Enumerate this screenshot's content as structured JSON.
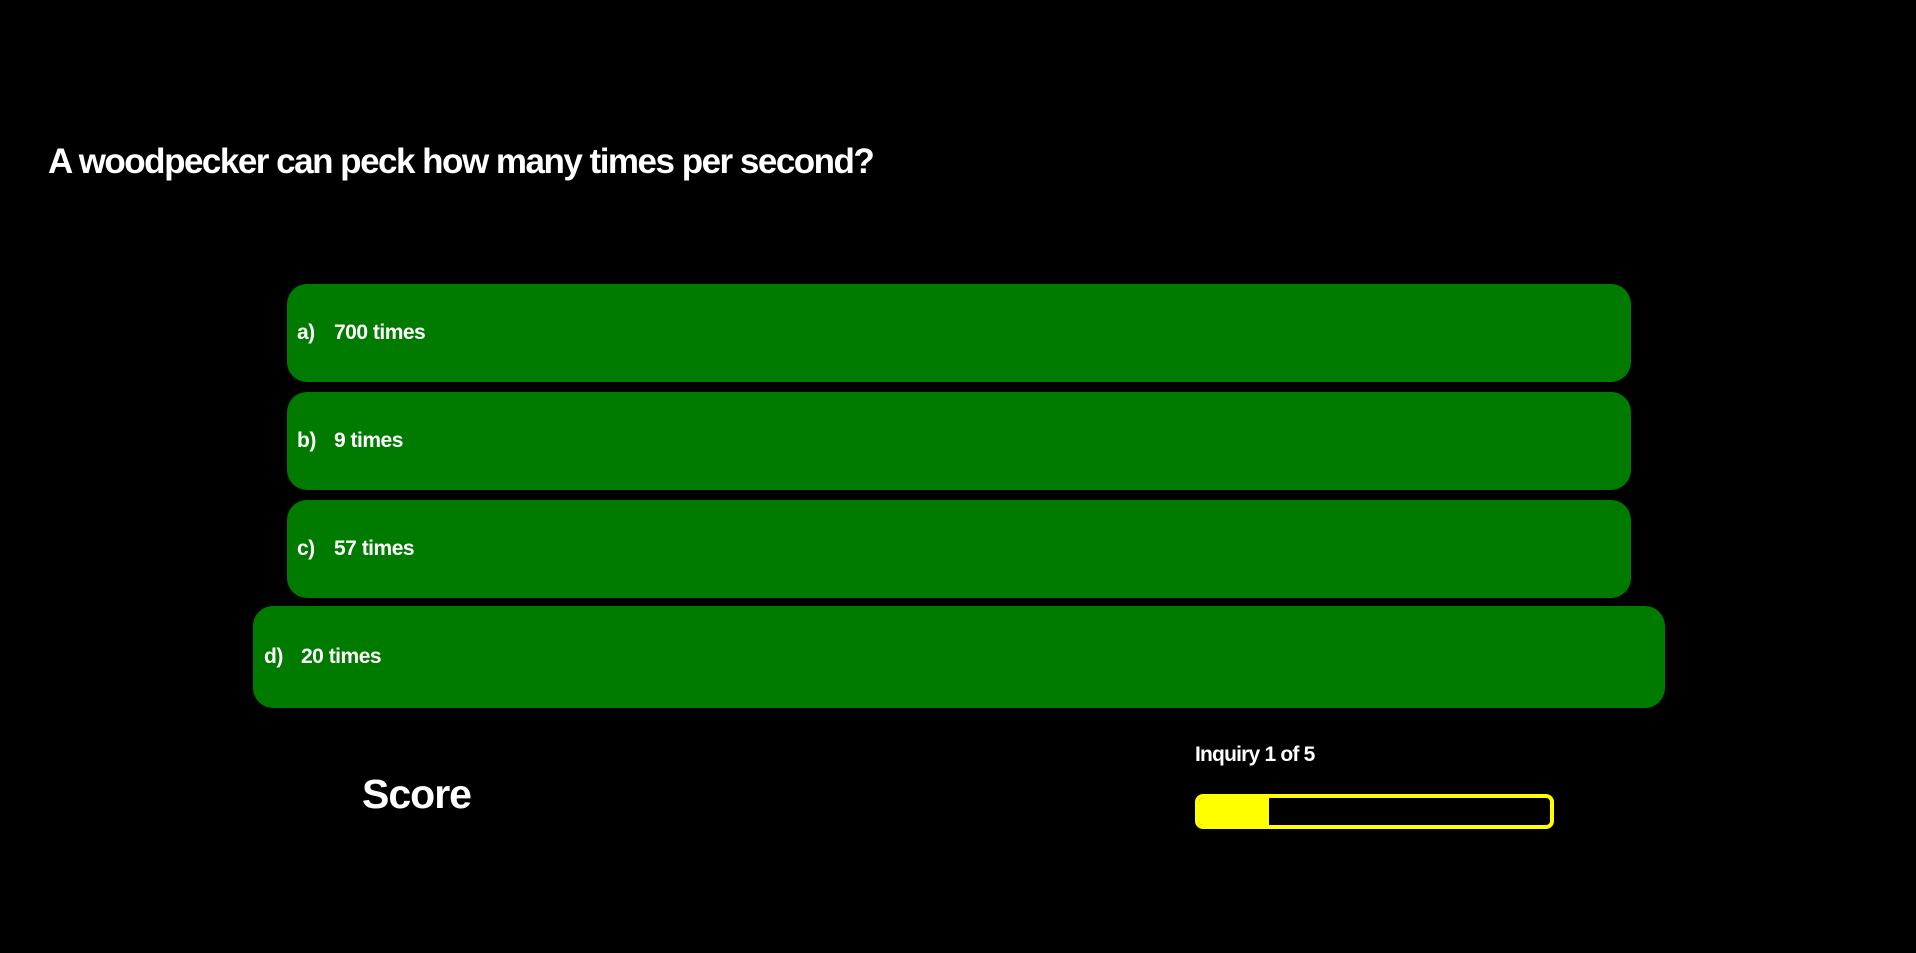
{
  "question": {
    "text": "A woodpecker can peck how many times per second?"
  },
  "options": [
    {
      "letter": "a)",
      "text": "700 times"
    },
    {
      "letter": "b)",
      "text": "9 times"
    },
    {
      "letter": "c)",
      "text": "57 times"
    },
    {
      "letter": "d)",
      "text": "20 times"
    }
  ],
  "score": {
    "label": "Score"
  },
  "progress": {
    "label": "Inquiry 1 of 5",
    "fraction": 0.2
  },
  "colors": {
    "background": "#000000",
    "option_background": "#007b00",
    "text": "#ffffff",
    "progress_accent": "#ffff00"
  }
}
